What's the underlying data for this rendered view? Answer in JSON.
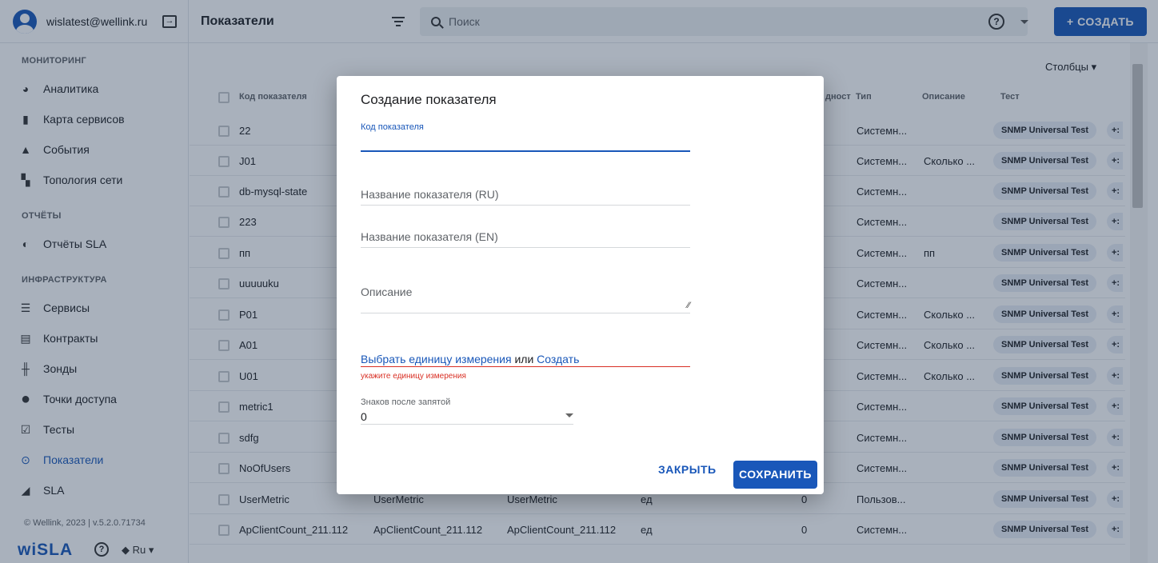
{
  "header": {
    "email": "wislatest@wellink.ru",
    "page_title": "Показатели",
    "search_placeholder": "Поиск",
    "create_label": "+ СОЗДАТЬ",
    "help": "?"
  },
  "sidebar": {
    "sections": [
      "МОНИТОРИНГ",
      "ОТЧЁТЫ",
      "ИНФРАСТРУКТУРА"
    ],
    "items": [
      {
        "label": "Аналитика"
      },
      {
        "label": "Карта сервисов"
      },
      {
        "label": "События"
      },
      {
        "label": "Топология сети"
      },
      {
        "label": "Отчёты SLA"
      },
      {
        "label": "Сервисы"
      },
      {
        "label": "Контракты"
      },
      {
        "label": "Зонды"
      },
      {
        "label": "Точки доступа"
      },
      {
        "label": "Тесты"
      },
      {
        "label": "Показатели"
      },
      {
        "label": "SLA"
      }
    ],
    "footer": "© Wellink, 2023 | v.5.2.0.71734",
    "logo": "wiSLA",
    "lang": "Ru"
  },
  "table": {
    "columns_button": "Столбцы",
    "headers": {
      "code": "Код показателя",
      "dim": "дност",
      "type": "Тип",
      "desc": "Описание",
      "test": "Тест"
    },
    "rows": [
      {
        "code": "22",
        "type": "Системн...",
        "desc": "",
        "test": "SNMP Universal Test",
        "more": "+:"
      },
      {
        "code": "J01",
        "type": "Системн...",
        "desc": "Сколько ...",
        "test": "SNMP Universal Test",
        "more": "+:"
      },
      {
        "code": "db-mysql-state",
        "type": "Системн...",
        "desc": "",
        "test": "SNMP Universal Test",
        "more": "+:"
      },
      {
        "code": "223",
        "type": "Системн...",
        "desc": "",
        "test": "SNMP Universal Test",
        "more": "+:"
      },
      {
        "code": "пп",
        "type": "Системн...",
        "desc": "пп",
        "test": "SNMP Universal Test",
        "more": "+:"
      },
      {
        "code": "uuuuuku",
        "type": "Системн...",
        "desc": "",
        "test": "SNMP Universal Test",
        "more": "+:"
      },
      {
        "code": "P01",
        "type": "Системн...",
        "desc": "Сколько ...",
        "test": "SNMP Universal Test",
        "more": "+:"
      },
      {
        "code": "A01",
        "type": "Системн...",
        "desc": "Сколько ...",
        "test": "SNMP Universal Test",
        "more": "+:"
      },
      {
        "code": "U01",
        "type": "Системн...",
        "desc": "Сколько ...",
        "test": "SNMP Universal Test",
        "more": "+:"
      },
      {
        "code": "metric1",
        "type": "Системн...",
        "desc": "",
        "test": "SNMP Universal Test",
        "more": "+:"
      },
      {
        "code": "sdfg",
        "type": "Системн...",
        "desc": "",
        "test": "SNMP Universal Test",
        "more": "+:"
      },
      {
        "code": "NoOfUsers",
        "type": "Системн...",
        "desc": "",
        "test": "SNMP Universal Test",
        "more": "+:"
      },
      {
        "code": "UserMetric",
        "name_ru": "UserMetric",
        "name_en": "UserMetric",
        "unit": "ед",
        "decimals": "0",
        "type": "Пользов...",
        "desc": "",
        "test": "SNMP Universal Test",
        "more": "+:"
      },
      {
        "code": "ApClientCount_211.112",
        "name_ru": "ApClientCount_211.112",
        "name_en": "ApClientCount_211.112",
        "unit": "ед",
        "decimals": "0",
        "type": "Системн...",
        "desc": "",
        "test": "SNMP Universal Test",
        "more": "+:"
      }
    ]
  },
  "dialog": {
    "title": "Создание показателя",
    "code_label": "Код показателя",
    "name_ru_placeholder": "Название показателя (RU)",
    "name_en_placeholder": "Название показателя (EN)",
    "description_placeholder": "Описание",
    "unit_select": "Выбрать единицу измерения",
    "unit_or": "или",
    "unit_create": "Создать",
    "unit_error": "укажите единицу измерения",
    "decimals_label": "Знаков после запятой",
    "decimals_value": "0",
    "close_label": "ЗАКРЫТЬ",
    "save_label": "СОХРАНИТЬ"
  }
}
